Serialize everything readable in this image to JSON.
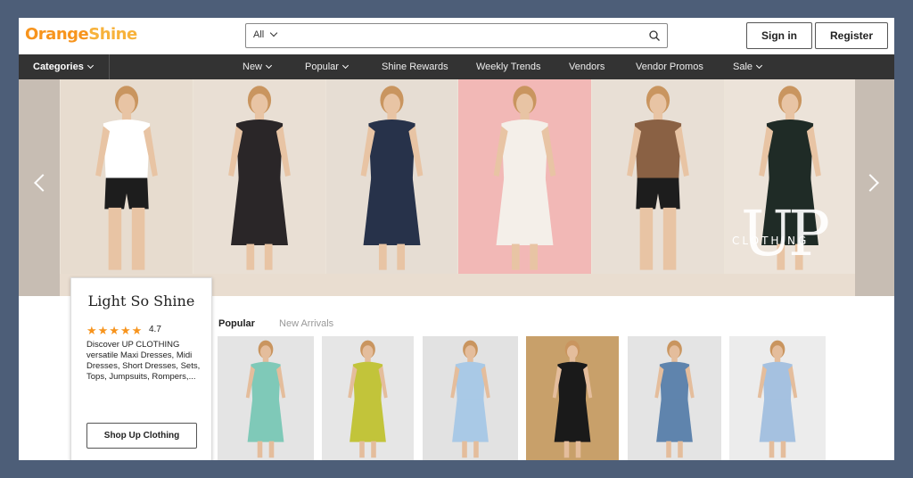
{
  "logo": {
    "orange": "Orange",
    "shine": "Shine"
  },
  "search": {
    "category": "All",
    "placeholder": ""
  },
  "auth": {
    "signin": "Sign in",
    "register": "Register"
  },
  "nav": {
    "categories": "Categories",
    "items": [
      {
        "label": "New",
        "dropdown": true
      },
      {
        "label": "Popular",
        "dropdown": true
      },
      {
        "label": "Shine Rewards",
        "dropdown": false
      },
      {
        "label": "Weekly Trends",
        "dropdown": false
      },
      {
        "label": "Vendors",
        "dropdown": false
      },
      {
        "label": "Vendor Promos",
        "dropdown": false
      },
      {
        "label": "Sale",
        "dropdown": true
      }
    ]
  },
  "banner": {
    "brand_big": "UP",
    "brand_small": "CLOTHING",
    "panels": [
      {
        "name": "white-tee-biker-shorts",
        "bg": "#e7dccf",
        "outfit": "#ffffff",
        "bottom": "#1d1d1d"
      },
      {
        "name": "black-floral-dress",
        "bg": "#e9dfd4",
        "outfit": "#2a2628",
        "bottom": "#2a2628"
      },
      {
        "name": "navy-maxi-dress",
        "bg": "#e6ddd3",
        "outfit": "#27324a",
        "bottom": "#27324a"
      },
      {
        "name": "white-floral-dress",
        "bg": "#f2b8b6",
        "outfit": "#f4efe9",
        "bottom": "#f4efe9"
      },
      {
        "name": "brown-tee-shorts",
        "bg": "#e8dfd5",
        "outfit": "#8a6144",
        "bottom": "#1d1d1d"
      },
      {
        "name": "floral-jumpsuit",
        "bg": "#ece3d9",
        "outfit": "#1f2b26",
        "bottom": "#1f2b26"
      }
    ]
  },
  "vendor": {
    "name": "Light So Shine",
    "stars": "★★★★★",
    "rating": "4.7",
    "description": "Discover UP CLOTHING versatile Maxi Dresses, Midi Dresses, Short Dresses, Sets, Tops, Jumpsuits, Rompers,...",
    "shop_label": "Shop Up Clothing"
  },
  "tabs": {
    "popular": "Popular",
    "new_arrivals": "New Arrivals"
  },
  "products": [
    {
      "name": "mint-floral-dress",
      "bg": "#e4e4e4",
      "color": "#7fc9b8"
    },
    {
      "name": "lime-two-piece-set",
      "bg": "#e6e6e6",
      "color": "#c2c43a"
    },
    {
      "name": "light-blue-dress",
      "bg": "#e2e2e2",
      "color": "#a9c9e6"
    },
    {
      "name": "black-wide-pants",
      "bg": "#c8a06a",
      "color": "#1a1a1a"
    },
    {
      "name": "denim-overalls",
      "bg": "#e4e4e4",
      "color": "#5f84ad"
    },
    {
      "name": "gingham-set",
      "bg": "#ececec",
      "color": "#a5c1e0"
    }
  ],
  "colors": {
    "accent": "#f7941d",
    "nav_bg": "#333333",
    "page_bg": "#4d5e78"
  }
}
